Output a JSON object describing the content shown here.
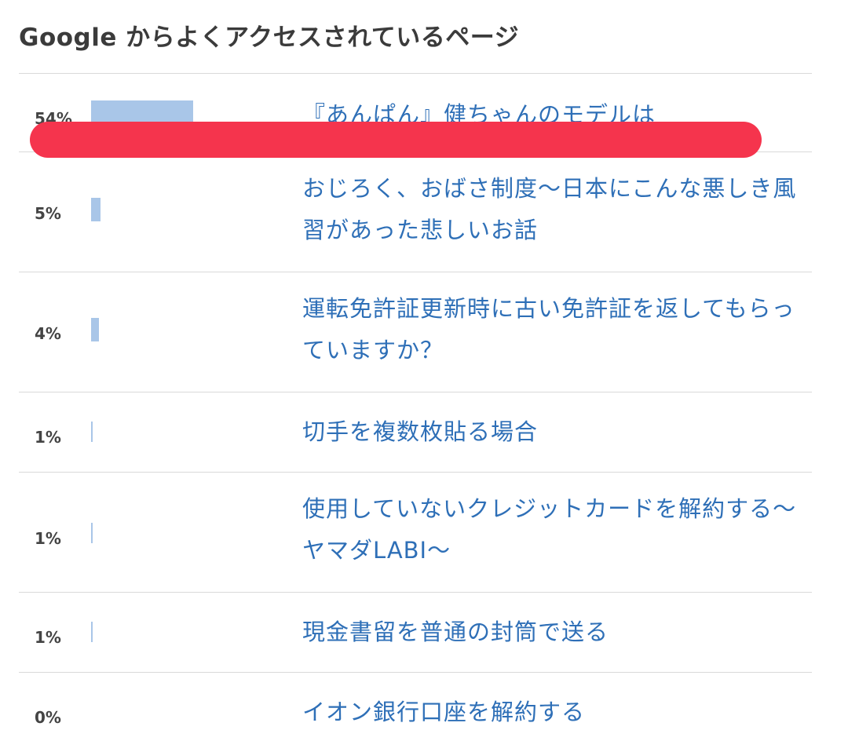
{
  "widget": {
    "title": "Google からよくアクセスされているページ"
  },
  "items": [
    {
      "percent_label": "54%",
      "percent": 54,
      "title": "『あんぱん』健ちゃんのモデルは"
    },
    {
      "percent_label": "5%",
      "percent": 5,
      "title": "おじろく、おばさ制度〜日本にこんな悪しき風習があった悲しいお話"
    },
    {
      "percent_label": "4%",
      "percent": 4,
      "title": "運転免許証更新時に古い免許証を返してもらっていますか？"
    },
    {
      "percent_label": "1%",
      "percent": 1,
      "title": "切手を複数枚貼る場合"
    },
    {
      "percent_label": "1%",
      "percent": 1,
      "title": "使用していないクレジットカードを解約する〜ヤマダLABI〜"
    },
    {
      "percent_label": "1%",
      "percent": 1,
      "title": "現金書留を普通の封筒で送る"
    },
    {
      "percent_label": "0%",
      "percent": 0,
      "title": "イオン銀行口座を解約する"
    }
  ],
  "colors": {
    "bar": "#a9c6e8",
    "link": "#2e6fb7",
    "redaction": "#f5344d"
  }
}
